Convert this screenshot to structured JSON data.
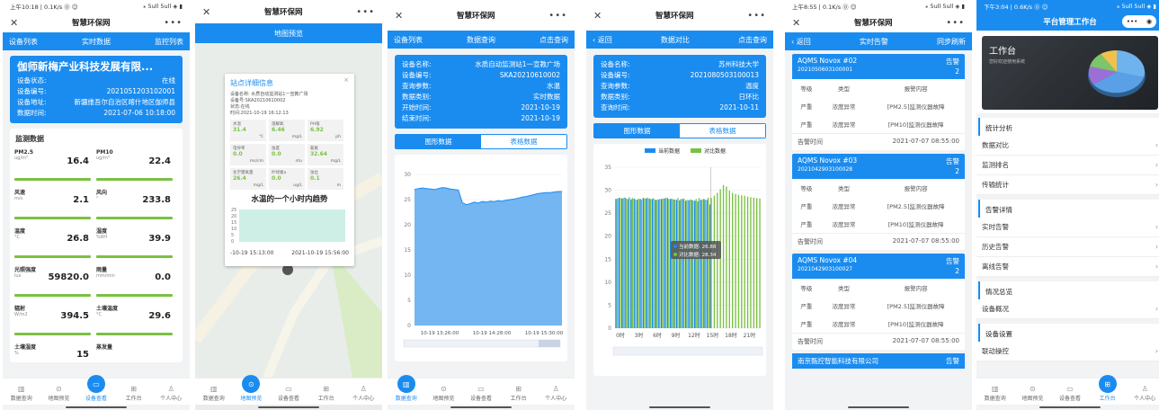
{
  "s1": {
    "status": {
      "time": "上午10:18 | 0.1K/s ⓪ ☺",
      "icons": "⁎ 5ull 5ull ◈ ▮"
    },
    "title": "智慧环保网",
    "nav": [
      "设备列表",
      "实时数据",
      "监控列表"
    ],
    "company": "伽师新梅产业科技发展有限...",
    "info": [
      [
        "设备状态:",
        "在线"
      ],
      [
        "设备编号:",
        "2021051203102001"
      ],
      [
        "设备地址:",
        "新疆维吾尔自治区喀什地区伽师县"
      ],
      [
        "数据时间:",
        "2021-07-06 10:18:00"
      ]
    ],
    "section": "监测数据",
    "metrics": [
      {
        "name": "PM2.5",
        "unit": "ug/m³",
        "value": "16.4"
      },
      {
        "name": "PM10",
        "unit": "ug/m³",
        "value": "22.4"
      },
      {
        "name": "风速",
        "unit": "m/s",
        "value": "2.1"
      },
      {
        "name": "风向",
        "unit": "°",
        "value": "233.8"
      },
      {
        "name": "温度",
        "unit": "°C",
        "value": "26.8"
      },
      {
        "name": "湿度",
        "unit": "%RH",
        "value": "39.9"
      },
      {
        "name": "光照强度",
        "unit": "lux",
        "value": "59820.0"
      },
      {
        "name": "雨量",
        "unit": "mm/min",
        "value": "0.0"
      },
      {
        "name": "辐射",
        "unit": "W/m2",
        "value": "394.5"
      },
      {
        "name": "土壤温度",
        "unit": "°C",
        "value": "29.6"
      },
      {
        "name": "土壤湿度",
        "unit": "%",
        "value": "15"
      },
      {
        "name": "蒸发量",
        "unit": "",
        "value": ""
      }
    ]
  },
  "s2": {
    "title": "智慧环保网",
    "header": "地图预览",
    "popup": {
      "title": "站点详细信息",
      "lines": [
        "设备名称: 水质自动监测站1一宣教广场",
        "设备号:SKA20210610002",
        "状态:在线",
        "时间:2021-10-19 16:12:13"
      ],
      "cells": [
        {
          "n": "水温",
          "v": "31.4",
          "u": "℃"
        },
        {
          "n": "溶解氧",
          "v": "6.46",
          "u": "mg/L"
        },
        {
          "n": "PH值",
          "v": "6.92",
          "u": "ph"
        },
        {
          "n": "电导率",
          "v": "0.0",
          "u": "ms/cm"
        },
        {
          "n": "浊度",
          "v": "0.0",
          "u": "ntu"
        },
        {
          "n": "氨氮",
          "v": "32.64",
          "u": "mg/L"
        },
        {
          "n": "化学需氧量",
          "v": "26.4",
          "u": "mg/L"
        },
        {
          "n": "叶绿素a",
          "v": "0.0",
          "u": "ug/L"
        },
        {
          "n": "浊位",
          "v": "0.1",
          "u": "m"
        }
      ],
      "chart_title": "水温的一个小时内趋势",
      "ticks": [
        "25",
        "20",
        "15",
        "10",
        "5",
        "0"
      ],
      "xstart": "-10-19 15:13:00",
      "xend": "2021-10-19 15:56:00"
    }
  },
  "s3": {
    "title": "智慧环保网",
    "nav": [
      "设备列表",
      "数据查询",
      "点击查询"
    ],
    "info": [
      [
        "设备名称:",
        "水质自动监测站1一宣教广场"
      ],
      [
        "设备编号:",
        "SKA20210610002"
      ],
      [
        "查询参数:",
        "水温"
      ],
      [
        "数据类别:",
        "实时数据"
      ],
      [
        "开始时间:",
        "2021-10-19"
      ],
      [
        "结束时间:",
        "2021-10-19"
      ]
    ],
    "seg": [
      "图形数据",
      "表格数据"
    ]
  },
  "s4": {
    "title": "智慧环保网",
    "nav": [
      "返回",
      "数据对比",
      "点击查询"
    ],
    "info": [
      [
        "设备名称:",
        "苏州科技大学"
      ],
      [
        "设备编号:",
        "2021080503100013"
      ],
      [
        "查询参数:",
        "温度"
      ],
      [
        "数据类别:",
        "日环比"
      ],
      [
        "查询时间:",
        "2021-10-11"
      ]
    ],
    "seg": [
      "图形数据",
      "表格数据"
    ],
    "tooltip": [
      "当前数据: 26.88",
      "对比数据: 28.34"
    ]
  },
  "s5": {
    "status": {
      "time": "上午8:55 | 0.1K/s ⓪ ☺",
      "icons": "⁎ 5ull 5ull ◈ ▮"
    },
    "title": "智慧环保网",
    "nav": [
      "返回",
      "实时告警",
      "同步刷新"
    ],
    "alarms": [
      {
        "name": "AQMS Novox #02",
        "id": "2021050603100001",
        "badge": "告警",
        "count": "2",
        "head": [
          "等级",
          "类型",
          "报警内容"
        ],
        "rows": [
          [
            "严重",
            "浓度异常",
            "[PM2.5]监测仪器故障"
          ],
          [
            "严重",
            "浓度异常",
            "[PM10]监测仪器故障"
          ]
        ],
        "time_label": "告警时间",
        "time": "2021-07-07 08:55:00"
      },
      {
        "name": "AQMS Novox #03",
        "id": "2021042903100028",
        "badge": "告警",
        "count": "2",
        "head": [
          "等级",
          "类型",
          "报警内容"
        ],
        "rows": [
          [
            "严重",
            "浓度异常",
            "[PM2.5]监测仪器故障"
          ],
          [
            "严重",
            "浓度异常",
            "[PM10]监测仪器故障"
          ]
        ],
        "time_label": "告警时间",
        "time": "2021-07-07 08:55:00"
      },
      {
        "name": "AQMS Novox #04",
        "id": "2021042903100027",
        "badge": "告警",
        "count": "2",
        "head": [
          "等级",
          "类型",
          "报警内容"
        ],
        "rows": [
          [
            "严重",
            "浓度异常",
            "[PM2.5]监测仪器故障"
          ],
          [
            "严重",
            "浓度异常",
            "[PM10]监测仪器故障"
          ]
        ],
        "time_label": "告警时间",
        "time": "2021-07-07 08:55:00"
      }
    ],
    "last": {
      "name": "南京甄控智能科技有限公司",
      "badge": "告警"
    }
  },
  "s6": {
    "status": {
      "time": "下午3:04 | 0.6K/s ⓪ ☺",
      "icons": "⁎ 5ull 5ull ◈ ▮"
    },
    "title": "平台管理工作台",
    "banner": {
      "title": "工作台",
      "sub": "您好欢迎使用系统"
    },
    "sections": [
      {
        "name": "统计分析",
        "items": [
          "数据对比",
          "监测排名",
          "传输统计"
        ]
      },
      {
        "name": "告警详情",
        "items": [
          "实时告警",
          "历史告警",
          "离线告警"
        ]
      },
      {
        "name": "情况总览",
        "items": [
          "设备概况"
        ]
      },
      {
        "name": "设备设置",
        "items": [
          "联动操控"
        ]
      }
    ]
  },
  "tabs": [
    "数据查询",
    "地图预览",
    "设备查看",
    "工作台",
    "个人中心"
  ],
  "colors": {
    "blue": "#1a8cf0",
    "green": "#7ac142"
  },
  "chart_data": [
    {
      "type": "area",
      "series": [
        {
          "values": [
            27,
            27.2,
            27.3,
            27.2,
            27.1,
            27,
            27.2,
            27.4,
            27.3,
            27.1,
            27,
            26.9,
            24.4,
            24,
            24.2,
            24.5,
            24.3,
            24.6,
            24.5,
            24.7,
            24.6,
            24.8,
            24.7,
            24.9,
            25,
            25.1,
            25.3,
            25.5,
            25.6,
            25.8,
            26,
            26.2,
            26.3,
            26.4,
            26.4,
            26.5,
            26.6,
            26.6
          ]
        }
      ],
      "yticks": [
        "30",
        "25",
        "20",
        "15",
        "10",
        "5",
        "0"
      ],
      "ylim": [
        0,
        30
      ],
      "xticks": [
        "10-19 13:26:00",
        "10-19 14:28:00",
        "10-19 15:30:00"
      ]
    },
    {
      "type": "bar",
      "series": [
        {
          "name": "当前数据",
          "values": [
            28.1,
            28.3,
            28.2,
            28.4,
            28.1,
            28,
            28.2,
            27.9,
            28.1,
            28.3,
            28.2,
            28.2,
            28.1,
            27.9,
            28,
            28.1,
            28.2,
            28.3,
            28.1,
            28,
            27.9,
            27.8,
            28.1,
            27.7,
            27.8,
            27.9,
            27.7,
            27.6,
            27.9,
            28.1,
            27.9,
            26.9
          ]
        },
        {
          "name": "对比数据",
          "values": [
            28.2,
            28.4,
            28.3,
            28.2,
            28.5,
            28.3,
            28,
            28.2,
            28,
            28.3,
            28.4,
            28.1,
            28.3,
            27.9,
            28.1,
            28.2,
            28.4,
            28.1,
            28.2,
            28,
            28.3,
            28.1,
            28.2,
            27.9,
            28,
            27.8,
            28.1,
            28.3,
            28,
            27.9,
            28.4,
            28.34,
            28.8,
            29.4,
            30.2,
            31.1,
            30.8,
            29.9,
            29.4,
            29.2,
            29,
            28.9,
            28.8,
            28.6,
            28.5,
            28.4,
            28.3,
            28.2
          ]
        }
      ],
      "yticks": [
        "35",
        "30",
        "25",
        "20",
        "15",
        "10",
        "5",
        "0"
      ],
      "ylim": [
        0,
        35
      ],
      "xticks": [
        "0时",
        "3时",
        "6时",
        "9时",
        "12时",
        "15时",
        "18时",
        "21时"
      ]
    }
  ]
}
